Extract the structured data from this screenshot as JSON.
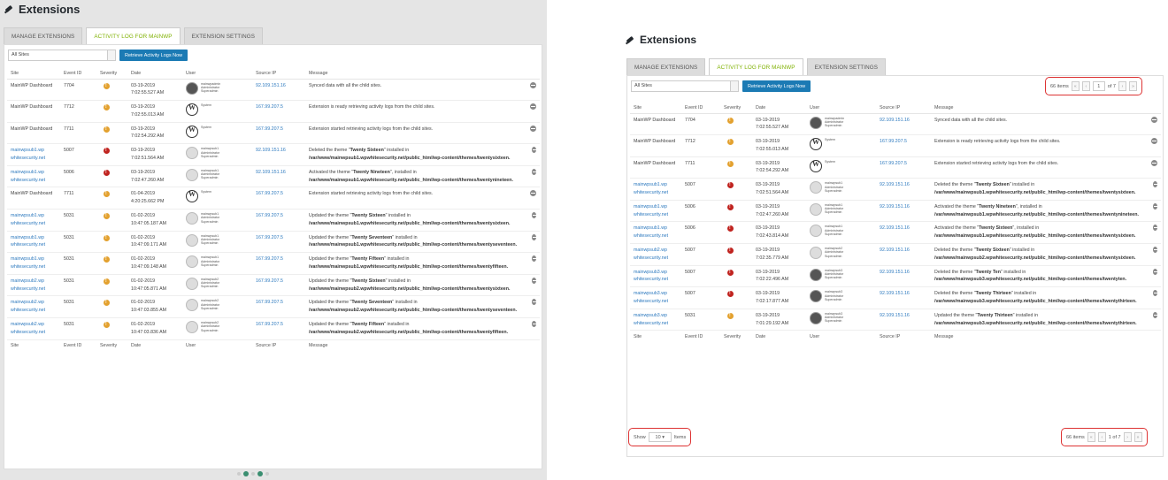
{
  "page": {
    "title": "Extensions"
  },
  "tabs": [
    "MANAGE EXTENSIONS",
    "ACTIVITY LOG FOR MAINWP",
    "EXTENSION SETTINGS"
  ],
  "toolbar": {
    "site_select": "All Sites",
    "retrieve_button": "Retrieve Activity Logs Now"
  },
  "columns": [
    "Site",
    "Event ID",
    "Severity",
    "Date",
    "User",
    "Source IP",
    "Message"
  ],
  "left_rows": [
    {
      "site": "MainWP Dashboard",
      "site_link": false,
      "event_id": "7704",
      "severity": "warning",
      "date": "03-19-2019",
      "time": "7:02:55.527 AM",
      "avatar": "photo",
      "user": [
        "mainwpadmin",
        "Administrator",
        "Superadmin"
      ],
      "ip": "92.109.151.16",
      "msg": [
        [
          "Synced data with all the child sites.",
          false
        ]
      ]
    },
    {
      "site": "MainWP Dashboard",
      "site_link": false,
      "event_id": "7712",
      "severity": "warning",
      "date": "03-19-2019",
      "time": "7:02:55.013 AM",
      "avatar": "wp",
      "user": [
        "System"
      ],
      "ip": "167.99.207.5",
      "msg": [
        [
          "Extension is ready retrieving activity logs from the child sites.",
          false
        ]
      ]
    },
    {
      "site": "MainWP Dashboard",
      "site_link": false,
      "event_id": "7711",
      "severity": "warning",
      "date": "03-19-2019",
      "time": "7:02:54.292 AM",
      "avatar": "wp",
      "user": [
        "System"
      ],
      "ip": "167.99.207.5",
      "msg": [
        [
          "Extension started retrieving activity logs from the child sites.",
          false
        ]
      ]
    },
    {
      "site": "mainwpsub1.wp whitesecurity.net",
      "site_link": true,
      "event_id": "5007",
      "severity": "error",
      "date": "03-19-2019",
      "time": "7:02:51.564 AM",
      "avatar": "gray",
      "user": [
        "mainwpsub1",
        "Administrator",
        "Superadmin"
      ],
      "ip": "92.109.151.16",
      "msg": [
        [
          "Deleted the theme \"",
          false
        ],
        [
          "Twenty Sixteen",
          true
        ],
        [
          "\" installed in ",
          false
        ],
        [
          "/var/www/mainwpsub1.wpwhitesecurity.net/public_html/wp-content/themes/twentysixteen.",
          true
        ]
      ]
    },
    {
      "site": "mainwpsub1.wp whitesecurity.net",
      "site_link": true,
      "event_id": "5006",
      "severity": "error",
      "date": "03-19-2019",
      "time": "7:02:47.260 AM",
      "avatar": "gray",
      "user": [
        "mainwpsub1",
        "Administrator",
        "Superadmin"
      ],
      "ip": "92.109.151.16",
      "msg": [
        [
          "Activated the theme \"",
          false
        ],
        [
          "Twenty Nineteen",
          true
        ],
        [
          "\", installed in ",
          false
        ],
        [
          "/var/www/mainwpsub1.wpwhitesecurity.net/public_html/wp-content/themes/twentynineteen.",
          true
        ]
      ]
    },
    {
      "site": "MainWP Dashboard",
      "site_link": false,
      "event_id": "7711",
      "severity": "warning",
      "date": "01-04-2019",
      "time": "4:20:25.662 PM",
      "avatar": "wp",
      "user": [
        "System"
      ],
      "ip": "167.99.207.5",
      "msg": [
        [
          "Extension started retrieving activity logs from the child sites.",
          false
        ]
      ]
    },
    {
      "site": "mainwpsub1.wp whitesecurity.net",
      "site_link": true,
      "event_id": "5031",
      "severity": "warning",
      "date": "01-02-2019",
      "time": "10:47:05.187 AM",
      "avatar": "gray",
      "user": [
        "mainwpsub1",
        "Administrator",
        "Superadmin"
      ],
      "ip": "167.99.207.5",
      "msg": [
        [
          "Updated the theme \"",
          false
        ],
        [
          "Twenty Sixteen",
          true
        ],
        [
          "\" installed in ",
          false
        ],
        [
          "/var/www/mainwpsub1.wpwhitesecurity.net/public_html/wp-content/themes/twentysixteen.",
          true
        ]
      ]
    },
    {
      "site": "mainwpsub1.wp whitesecurity.net",
      "site_link": true,
      "event_id": "5031",
      "severity": "warning",
      "date": "01-02-2019",
      "time": "10:47:09.171 AM",
      "avatar": "gray",
      "user": [
        "mainwpsub1",
        "Administrator",
        "Superadmin"
      ],
      "ip": "167.99.207.5",
      "msg": [
        [
          "Updated the theme \"",
          false
        ],
        [
          "Twenty Seventeen",
          true
        ],
        [
          "\" installed in ",
          false
        ],
        [
          "/var/www/mainwpsub1.wpwhitesecurity.net/public_html/wp-content/themes/twentyseventeen.",
          true
        ]
      ]
    },
    {
      "site": "mainwpsub1.wp whitesecurity.net",
      "site_link": true,
      "event_id": "5031",
      "severity": "warning",
      "date": "01-02-2019",
      "time": "10:47:09.148 AM",
      "avatar": "gray",
      "user": [
        "mainwpsub1",
        "Administrator",
        "Superadmin"
      ],
      "ip": "167.99.207.5",
      "msg": [
        [
          "Updated the theme \"",
          false
        ],
        [
          "Twenty Fifteen",
          true
        ],
        [
          "\" installed in ",
          false
        ],
        [
          "/var/www/mainwpsub1.wpwhitesecurity.net/public_html/wp-content/themes/twentyfifteen.",
          true
        ]
      ]
    },
    {
      "site": "mainwpsub2.wp whitesecurity.net",
      "site_link": true,
      "event_id": "5031",
      "severity": "warning",
      "date": "01-02-2019",
      "time": "10:47:05.871 AM",
      "avatar": "gray",
      "user": [
        "mainwpsub2",
        "Administrator",
        "Superadmin"
      ],
      "ip": "167.99.207.5",
      "msg": [
        [
          "Updated the theme \"",
          false
        ],
        [
          "Twenty Sixteen",
          true
        ],
        [
          "\" installed in ",
          false
        ],
        [
          "/var/www/mainwpsub2.wpwhitesecurity.net/public_html/wp-content/themes/twentysixteen.",
          true
        ]
      ]
    },
    {
      "site": "mainwpsub2.wp whitesecurity.net",
      "site_link": true,
      "event_id": "5031",
      "severity": "warning",
      "date": "01-02-2019",
      "time": "10:47:03.855 AM",
      "avatar": "gray",
      "user": [
        "mainwpsub2",
        "Administrator",
        "Superadmin"
      ],
      "ip": "167.99.207.5",
      "msg": [
        [
          "Updated the theme \"",
          false
        ],
        [
          "Twenty Seventeen",
          true
        ],
        [
          "\" installed in ",
          false
        ],
        [
          "/var/www/mainwpsub2.wpwhitesecurity.net/public_html/wp-content/themes/twentyseventeen.",
          true
        ]
      ]
    },
    {
      "site": "mainwpsub2.wp whitesecurity.net",
      "site_link": true,
      "event_id": "5031",
      "severity": "warning",
      "date": "01-02-2019",
      "time": "10:47:03.836 AM",
      "avatar": "gray",
      "user": [
        "mainwpsub2",
        "Administrator",
        "Superadmin"
      ],
      "ip": "167.99.207.5",
      "msg": [
        [
          "Updated the theme \"",
          false
        ],
        [
          "Twenty Fifteen",
          true
        ],
        [
          "\" installed in ",
          false
        ],
        [
          "/var/www/mainwpsub2.wpwhitesecurity.net/public_html/wp-content/themes/twentyfifteen.",
          true
        ]
      ]
    }
  ],
  "right_rows": [
    {
      "site": "MainWP Dashboard",
      "site_link": false,
      "event_id": "7704",
      "severity": "warning",
      "date": "03-19-2019",
      "time": "7:02:55.527 AM",
      "avatar": "photo",
      "user": [
        "mainwpadmin",
        "Administrator",
        "Superadmin"
      ],
      "ip": "92.109.151.16",
      "msg": [
        [
          "Synced data with all the child sites.",
          false
        ]
      ]
    },
    {
      "site": "MainWP Dashboard",
      "site_link": false,
      "event_id": "7712",
      "severity": "warning",
      "date": "03-19-2019",
      "time": "7:02:55.013 AM",
      "avatar": "wp",
      "user": [
        "System"
      ],
      "ip": "167.99.207.5",
      "msg": [
        [
          "Extension is ready retrieving activity logs from the child sites.",
          false
        ]
      ]
    },
    {
      "site": "MainWP Dashboard",
      "site_link": false,
      "event_id": "7711",
      "severity": "warning",
      "date": "03-19-2019",
      "time": "7:02:54.292 AM",
      "avatar": "wp",
      "user": [
        "System"
      ],
      "ip": "167.99.207.5",
      "msg": [
        [
          "Extension started retrieving activity logs from the child sites.",
          false
        ]
      ]
    },
    {
      "site": "mainwpsub1.wp whitesecurity.net",
      "site_link": true,
      "event_id": "5007",
      "severity": "error",
      "date": "03-19-2019",
      "time": "7:02:51.564 AM",
      "avatar": "gray",
      "user": [
        "mainwpsub1",
        "Administrator",
        "Superadmin"
      ],
      "ip": "92.109.151.16",
      "msg": [
        [
          "Deleted the theme \"",
          false
        ],
        [
          "Twenty Sixteen",
          true
        ],
        [
          "\" installed in ",
          false
        ],
        [
          "/var/www/mainwpsub1.wpwhitesecurity.net/public_html/wp-content/themes/twentysixteen.",
          true
        ]
      ]
    },
    {
      "site": "mainwpsub1.wp whitesecurity.net",
      "site_link": true,
      "event_id": "5006",
      "severity": "error",
      "date": "03-19-2019",
      "time": "7:02:47.260 AM",
      "avatar": "gray",
      "user": [
        "mainwpsub1",
        "Administrator",
        "Superadmin"
      ],
      "ip": "92.109.151.16",
      "msg": [
        [
          "Activated the theme \"",
          false
        ],
        [
          "Twenty Nineteen",
          true
        ],
        [
          "\", installed in ",
          false
        ],
        [
          "/var/www/mainwpsub1.wpwhitesecurity.net/public_html/wp-content/themes/twentynineteen.",
          true
        ]
      ]
    },
    {
      "site": "mainwpsub1.wp whitesecurity.net",
      "site_link": true,
      "event_id": "5006",
      "severity": "error",
      "date": "03-19-2019",
      "time": "7:02:43.814 AM",
      "avatar": "gray",
      "user": [
        "mainwpsub1",
        "Administrator",
        "Superadmin"
      ],
      "ip": "92.109.151.16",
      "msg": [
        [
          "Activated the theme \"",
          false
        ],
        [
          "Twenty Sixteen",
          true
        ],
        [
          "\", installed in ",
          false
        ],
        [
          "/var/www/mainwpsub1.wpwhitesecurity.net/public_html/wp-content/themes/twentysixteen.",
          true
        ]
      ]
    },
    {
      "site": "mainwpsub2.wp whitesecurity.net",
      "site_link": true,
      "event_id": "5007",
      "severity": "error",
      "date": "03-19-2019",
      "time": "7:02:35.779 AM",
      "avatar": "gray",
      "user": [
        "mainwpsub2",
        "Administrator",
        "Superadmin"
      ],
      "ip": "92.109.151.16",
      "msg": [
        [
          "Deleted the theme \"",
          false
        ],
        [
          "Twenty Sixteen",
          true
        ],
        [
          "\" installed in ",
          false
        ],
        [
          "/var/www/mainwpsub2.wpwhitesecurity.net/public_html/wp-content/themes/twentysixteen.",
          true
        ]
      ]
    },
    {
      "site": "mainwpsub3.wp whitesecurity.net",
      "site_link": true,
      "event_id": "5007",
      "severity": "error",
      "date": "03-19-2019",
      "time": "7:02:22.496 AM",
      "avatar": "photo",
      "user": [
        "mainwpsub3",
        "Administrator",
        "Superadmin"
      ],
      "ip": "92.109.151.16",
      "msg": [
        [
          "Deleted the theme \"",
          false
        ],
        [
          "Twenty Ten",
          true
        ],
        [
          "\" installed in ",
          false
        ],
        [
          "/var/www/mainwpsub3.wpwhitesecurity.net/public_html/wp-content/themes/twentyten.",
          true
        ]
      ]
    },
    {
      "site": "mainwpsub3.wp whitesecurity.net",
      "site_link": true,
      "event_id": "5007",
      "severity": "error",
      "date": "03-19-2019",
      "time": "7:02:17.877 AM",
      "avatar": "photo",
      "user": [
        "mainwpsub3",
        "Administrator",
        "Superadmin"
      ],
      "ip": "92.109.151.16",
      "msg": [
        [
          "Deleted the theme \"",
          false
        ],
        [
          "Twenty Thirteen",
          true
        ],
        [
          "\" installed in ",
          false
        ],
        [
          "/var/www/mainwpsub3.wpwhitesecurity.net/public_html/wp-content/themes/twentythirteen.",
          true
        ]
      ]
    },
    {
      "site": "mainwpsub3.wp whitesecurity.net",
      "site_link": true,
      "event_id": "5031",
      "severity": "warning",
      "date": "03-19-2019",
      "time": "7:01:29.192 AM",
      "avatar": "photo",
      "user": [
        "mainwpsub3",
        "Administrator",
        "Superadmin"
      ],
      "ip": "92.109.151.16",
      "msg": [
        [
          "Updated the theme \"",
          false
        ],
        [
          "Twenty Thirteen",
          true
        ],
        [
          "\" installed in ",
          false
        ],
        [
          "/var/www/mainwpsub3.wpwhitesecurity.net/public_html/wp-content/themes/twentythirteen.",
          true
        ]
      ]
    }
  ],
  "pagination": {
    "items_label": "66 items",
    "page": "1",
    "of_label": "of 7",
    "first": "«",
    "prev": "‹",
    "next": "›",
    "last": "»",
    "bottom_page": "1 of 7",
    "show_label": "Show",
    "show_value": "10",
    "items_word": "Items"
  },
  "colors": {
    "accent": "#7fb100",
    "link": "#2e7abf",
    "button": "#1b7ab4",
    "warning": "#e3a12f",
    "error": "#c0231f",
    "highlight": "#dd3333"
  }
}
